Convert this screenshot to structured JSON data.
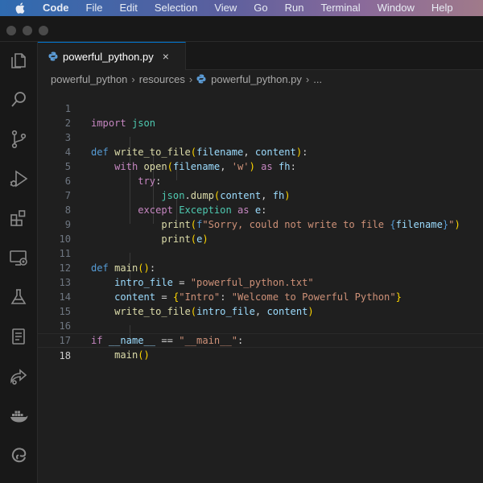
{
  "menubar": {
    "items": [
      "Code",
      "File",
      "Edit",
      "Selection",
      "View",
      "Go",
      "Run",
      "Terminal",
      "Window",
      "Help"
    ]
  },
  "activity_bar": {
    "icons": [
      "explorer-icon",
      "search-icon",
      "source-control-icon",
      "run-debug-icon",
      "extensions-icon",
      "remote-explorer-icon",
      "testing-icon",
      "notebook-icon",
      "live-share-icon",
      "docker-icon",
      "edge-devtools-icon"
    ]
  },
  "tab": {
    "filename": "powerful_python.py",
    "close_glyph": "×"
  },
  "breadcrumb": {
    "root": "powerful_python",
    "folder": "resources",
    "file": "powerful_python.py",
    "more": "..."
  },
  "editor": {
    "line_numbers": [
      "1",
      "2",
      "3",
      "4",
      "5",
      "6",
      "7",
      "8",
      "9",
      "10",
      "11",
      "12",
      "13",
      "14",
      "15",
      "16",
      "17",
      "18"
    ],
    "code": {
      "l1": {
        "import": "import",
        "module": "json"
      },
      "l3": {
        "def": "def",
        "name": "write_to_file",
        "lp": "(",
        "p1": "filename",
        "comma": ", ",
        "p2": "content",
        "rp": ")",
        "colon": ":"
      },
      "l4": {
        "with": "with",
        "open": "open",
        "lp": "(",
        "a1": "filename",
        "comma": ", ",
        "mode": "'w'",
        "rp": ")",
        "as": "as",
        "var": "fh",
        "colon": ":"
      },
      "l5": {
        "try": "try",
        "colon": ":"
      },
      "l6": {
        "obj": "json",
        "dot": ".",
        "method": "dump",
        "lp": "(",
        "a1": "content",
        "comma": ", ",
        "a2": "fh",
        "rp": ")"
      },
      "l7": {
        "except": "except",
        "exc": "Exception",
        "as": "as",
        "var": "e",
        "colon": ":"
      },
      "l8": {
        "print": "print",
        "lp": "(",
        "fprefix": "f",
        "str_a": "\"Sorry, could not write to file ",
        "lbrace": "{",
        "interp": "filename",
        "rbrace": "}",
        "str_b": "\"",
        "rp": ")"
      },
      "l9": {
        "print": "print",
        "lp": "(",
        "arg": "e",
        "rp": ")"
      },
      "l11": {
        "def": "def",
        "name": "main",
        "lp": "(",
        "rp": ")",
        "colon": ":"
      },
      "l12": {
        "var": "intro_file",
        "eq": " = ",
        "val": "\"powerful_python.txt\""
      },
      "l13": {
        "var": "content",
        "eq": " = ",
        "lb": "{",
        "key": "\"Intro\"",
        "colon": ": ",
        "val": "\"Welcome to Powerful Python\"",
        "rb": "}"
      },
      "l14": {
        "name": "write_to_file",
        "lp": "(",
        "a1": "intro_file",
        "comma": ", ",
        "a2": "content",
        "rp": ")"
      },
      "l16": {
        "if": "if",
        "dunder": "__name__",
        "eq": " == ",
        "val": "\"__main__\"",
        "colon": ":"
      },
      "l17": {
        "name": "main",
        "lp": "(",
        "rp": ")"
      }
    }
  },
  "colors": {
    "keyword_control": "#c586c0",
    "keyword_def": "#569cd6",
    "function": "#dcdcaa",
    "variable": "#9cdcfe",
    "string": "#ce9178",
    "class": "#4ec9b0",
    "bracket_1": "#ffd700",
    "bracket_2": "#da70d6",
    "bracket_3": "#179fff"
  }
}
